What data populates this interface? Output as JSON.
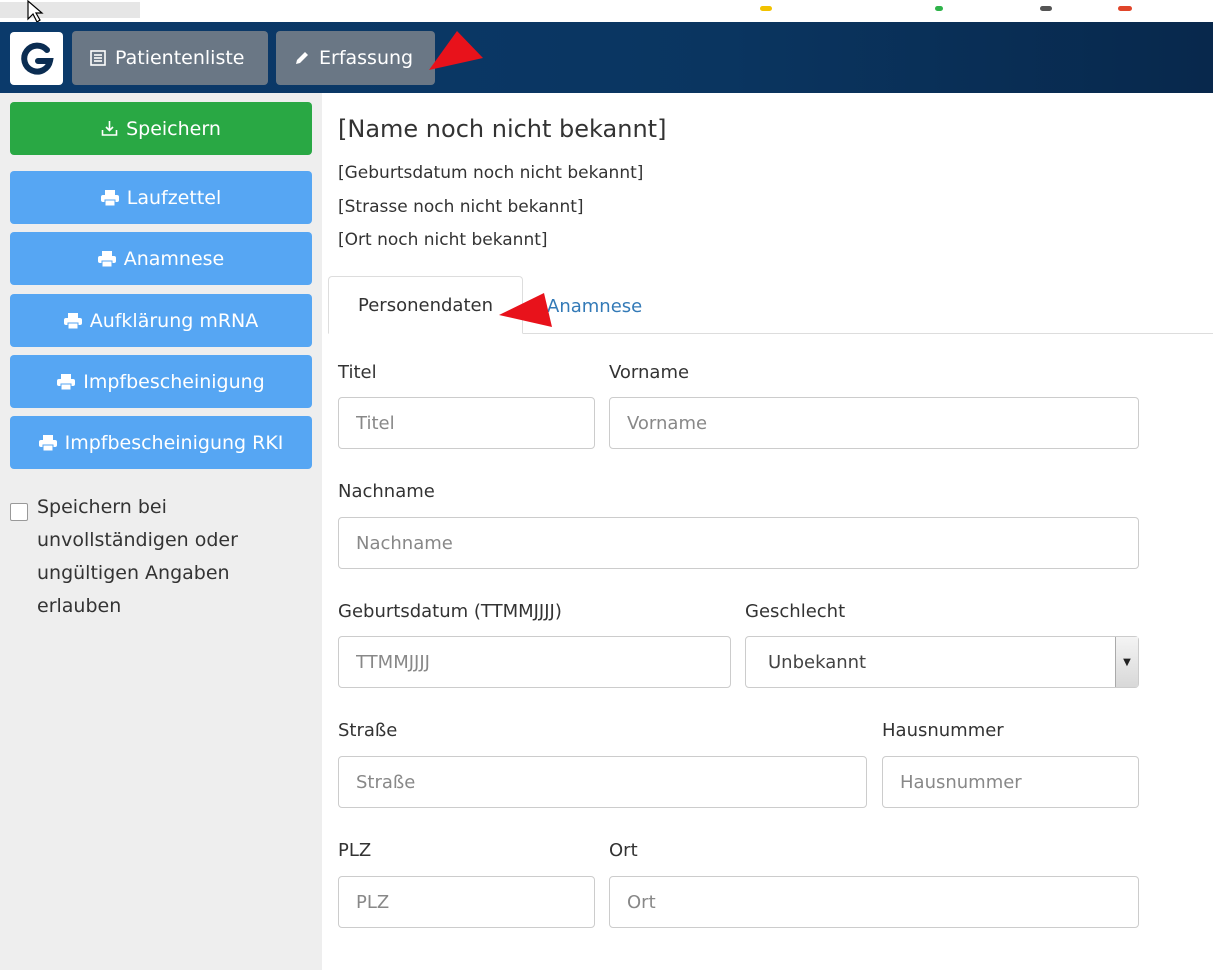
{
  "navbar": {
    "patients_label": "Patientenliste",
    "capture_label": "Erfassung",
    "logo_letter": "G"
  },
  "sidebar": {
    "save_label": "Speichern",
    "buttons": [
      {
        "label": "Laufzettel",
        "icon": "printer-icon"
      },
      {
        "label": "Anamnese",
        "icon": "printer-icon"
      },
      {
        "label": "Aufklärung mRNA",
        "icon": "printer-icon"
      },
      {
        "label": "Impfbescheinigung",
        "icon": "printer-icon"
      },
      {
        "label": "Impfbescheinigung RKI",
        "icon": "printer-icon"
      }
    ],
    "allow_incomplete_label": "Speichern bei unvollständigen oder ungültigen Angaben erlauben",
    "allow_incomplete_checked": false
  },
  "patient": {
    "name": "[Name noch nicht bekannt]",
    "birthdate": "[Geburtsdatum noch nicht bekannt]",
    "street": "[Strasse noch nicht bekannt]",
    "city": "[Ort noch nicht bekannt]"
  },
  "tabs": {
    "personal": "Personendaten",
    "anamnesis": "Anamnese"
  },
  "form": {
    "title": {
      "label": "Titel",
      "placeholder": "Titel",
      "value": ""
    },
    "firstname": {
      "label": "Vorname",
      "placeholder": "Vorname",
      "value": ""
    },
    "lastname": {
      "label": "Nachname",
      "placeholder": "Nachname",
      "value": ""
    },
    "birthdate": {
      "label": "Geburtsdatum (TTMMJJJJ)",
      "placeholder": "TTMMJJJJ",
      "value": ""
    },
    "gender": {
      "label": "Geschlecht",
      "selected": "Unbekannt"
    },
    "street": {
      "label": "Straße",
      "placeholder": "Straße",
      "value": ""
    },
    "housenumber": {
      "label": "Hausnummer",
      "placeholder": "Hausnummer",
      "value": ""
    },
    "zip": {
      "label": "PLZ",
      "placeholder": "PLZ",
      "value": ""
    },
    "city": {
      "label": "Ort",
      "placeholder": "Ort",
      "value": ""
    }
  },
  "colors": {
    "navbar": "#0b3a6b",
    "save_button": "#29a844",
    "print_button": "#56a6f3",
    "link": "#337ab7",
    "annotation_arrow": "#e8121b"
  }
}
